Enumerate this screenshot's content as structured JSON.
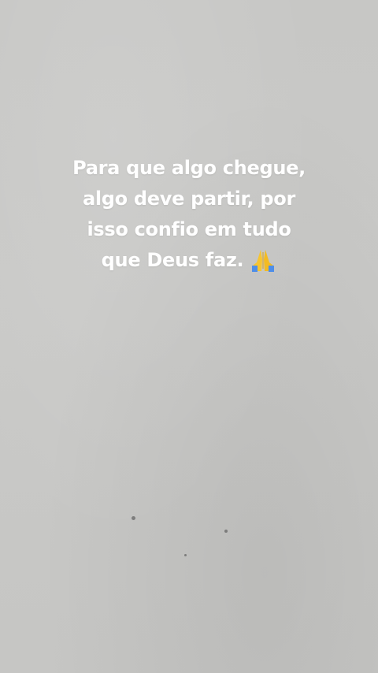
{
  "story": {
    "caption_lines": [
      "Para que algo chegue,",
      "algo deve partir, por",
      "isso confio em tudo",
      "que Deus faz."
    ],
    "emoji": "folded-hands-icon"
  },
  "colors": {
    "background": "#c8c8c6",
    "text": "#ffffff"
  }
}
